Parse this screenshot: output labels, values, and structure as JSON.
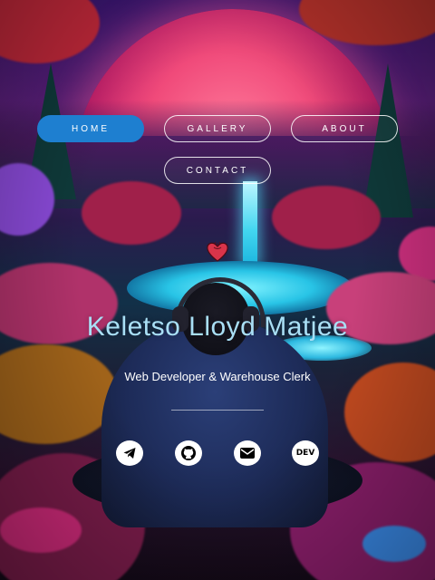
{
  "nav": {
    "home": "HOME",
    "gallery": "GALLERY",
    "about": "ABOUT",
    "contact": "CONTACT",
    "active": "home"
  },
  "hero": {
    "logo_icon": "heart-logo-icon",
    "name": "Keletso Lloyd Matjee",
    "tagline": "Web Developer & Warehouse Clerk"
  },
  "social": [
    {
      "icon": "telegram-icon"
    },
    {
      "icon": "github-icon"
    },
    {
      "icon": "email-icon"
    },
    {
      "icon": "dev-icon",
      "label": "DEV"
    }
  ],
  "colors": {
    "accent": "#1e7fd0",
    "name_text": "#a9dff5",
    "text": "#ffffff"
  }
}
